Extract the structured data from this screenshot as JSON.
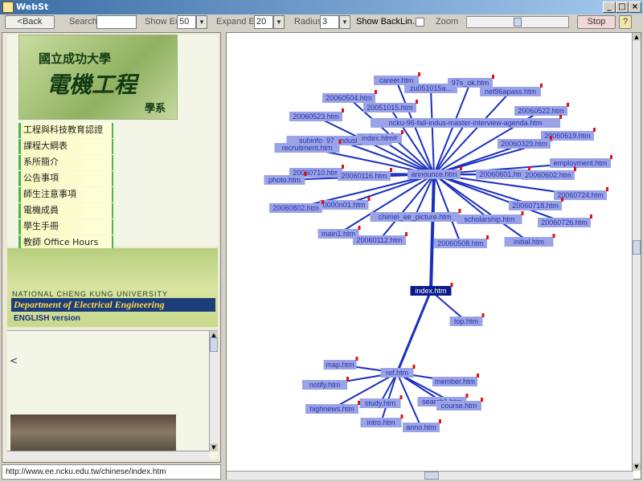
{
  "window": {
    "title": "WebSt"
  },
  "toolbar": {
    "back_label": "<Back",
    "search_label": "Search",
    "search_value": "",
    "show_label": "Show E#",
    "show_value": "50",
    "expand_label": "Expand E#",
    "expand_value": "20",
    "radius_label": "Radius",
    "radius_value": "3",
    "backlinks_label": "Show BackLin...",
    "zoom_label": "Zoom",
    "stop_label": "Stop",
    "help_label": "?"
  },
  "left": {
    "logo_title": "國立成功大學",
    "logo_dept": "電機工程",
    "logo_suffix": "學系",
    "menu": [
      "工程與科技教育認證",
      "課程大綱表",
      "系所簡介",
      "公告事項",
      "師生注意事項",
      "電機成員",
      "學生手冊",
      "教師 Office Hours"
    ],
    "english_univ": "NATIONAL CHENG KUNG UNIVERSITY",
    "english_dept": "Department of Electrical Engineering",
    "english_version": "ENGLISH version",
    "lower_text": "<",
    "status_url": "http://www.ee.ncku.edu.tw/chinese/index.htm"
  },
  "graph": {
    "hubs": [
      {
        "label": "announce.htm"
      },
      {
        "label": "index.htm"
      },
      {
        "label": "ref.htm"
      }
    ],
    "announce_nodes": [
      "career.htm",
      "zu051015a...",
      "97s_ok.htm",
      "20060504.htm",
      "net96apass.htm",
      "20051015.htm",
      "20060522.htm",
      "20060523.htm",
      "ncku-96-fall-indus-master-interview-agenda.htm",
      "20060619.htm",
      "subinfo_97_indust_inte...",
      "index.htm#",
      "20060329.htm",
      "recruitment.htm",
      "employment.htm",
      "20060710.htm",
      "20060116.htm",
      "20060601.htm",
      "20060602.htm",
      "photo.htm",
      "20060724.htm",
      "0000n01.htm",
      "20060718.htm",
      "20060802.htm",
      "chimei_ee_picture.htm",
      "scholarship.htm",
      "20060726.htm",
      "main1.htm",
      "20060112.htm",
      "20060508.htm",
      "initial.htm"
    ],
    "index_nodes": [
      "top.htm"
    ],
    "ref_nodes": [
      "map.htm",
      "notify.htm",
      "member.htm",
      "study.htm",
      "highnews.htm",
      "search1.htm",
      "course.htm",
      "intro.htm",
      "anno.htm"
    ],
    "node_color": "#9aa3e6",
    "edge_color": "#1a2fc0",
    "hub_color": "#0a1a8a",
    "marker_color": "#e01010"
  }
}
